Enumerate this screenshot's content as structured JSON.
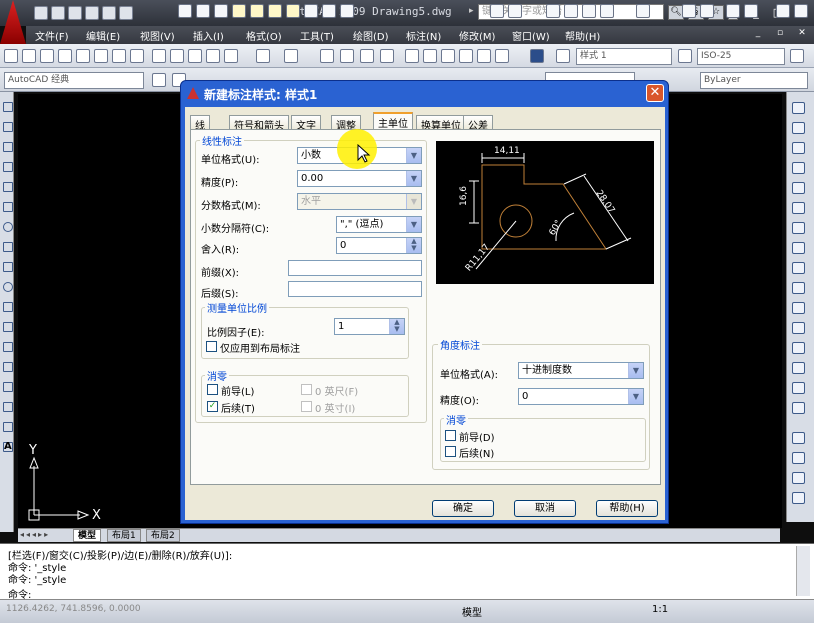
{
  "app": {
    "title": "AutoCAD 2009 Drawing5.dwg",
    "search_placeholder": "键入关键字或短语",
    "menus": [
      "文件(F)",
      "编辑(E)",
      "视图(V)",
      "插入(I)",
      "格式(O)",
      "工具(T)",
      "绘图(D)",
      "标注(N)",
      "修改(M)",
      "窗口(W)",
      "帮助(H)"
    ],
    "workspace": "AutoCAD 经典",
    "text_style": "样式 1",
    "iso_style": "ISO-25",
    "bylayer": "ByLayer"
  },
  "ucs": {
    "x": "X",
    "y": "Y"
  },
  "model_tabs": [
    "模型",
    "布局1",
    "布局2"
  ],
  "command": {
    "lines": [
      "[栏选(F)/窗交(C)/投影(P)/边(E)/删除(R)/放弃(U)]:",
      "命令: '_style",
      "命令: '_style",
      "命令:"
    ]
  },
  "status": {
    "coords": "1126.4262, 741.8596, 0.0000",
    "model": "模型",
    "scale": "1:1"
  },
  "dialog": {
    "title": "新建标注样式: 样式1",
    "tabs": [
      "线",
      "符号和箭头",
      "文字",
      "调整",
      "主单位",
      "换算单位",
      "公差"
    ],
    "active_tab": "主单位",
    "linear": {
      "group_title": "线性标注",
      "unit_format_label": "单位格式(U):",
      "unit_format_value": "小数",
      "precision_label": "精度(P):",
      "precision_value": "0.00",
      "fraction_label": "分数格式(M):",
      "fraction_value": "水平",
      "decimal_sep_label": "小数分隔符(C):",
      "decimal_sep_value": "\",\"  (逗点)",
      "round_label": "舍入(R):",
      "round_value": "0",
      "prefix_label": "前缀(X):",
      "suffix_label": "后缀(S):",
      "prefix_value": "",
      "suffix_value": ""
    },
    "scale": {
      "group_title": "测量单位比例",
      "factor_label": "比例因子(E):",
      "factor_value": "1",
      "layout_only_label": "仅应用到布局标注"
    },
    "zero_left": {
      "group_title": "消零",
      "leading_label": "前导(L)",
      "trailing_label": "后续(T)",
      "feet_label": "0 英尺(F)",
      "inches_label": "0 英寸(I)"
    },
    "angular": {
      "group_title": "角度标注",
      "unit_format_label": "单位格式(A):",
      "unit_format_value": "十进制度数",
      "precision_label": "精度(O):",
      "precision_value": "0",
      "zero_title": "消零",
      "leading_label": "前导(D)",
      "trailing_label": "后续(N)"
    },
    "buttons": {
      "ok": "确定",
      "cancel": "取消",
      "help": "帮助(H)"
    },
    "preview": {
      "dim_top": "14,11",
      "dim_left": "16,6",
      "dim_right": "28,07",
      "dim_angle": "60°",
      "dim_radius": "R11,17"
    }
  }
}
